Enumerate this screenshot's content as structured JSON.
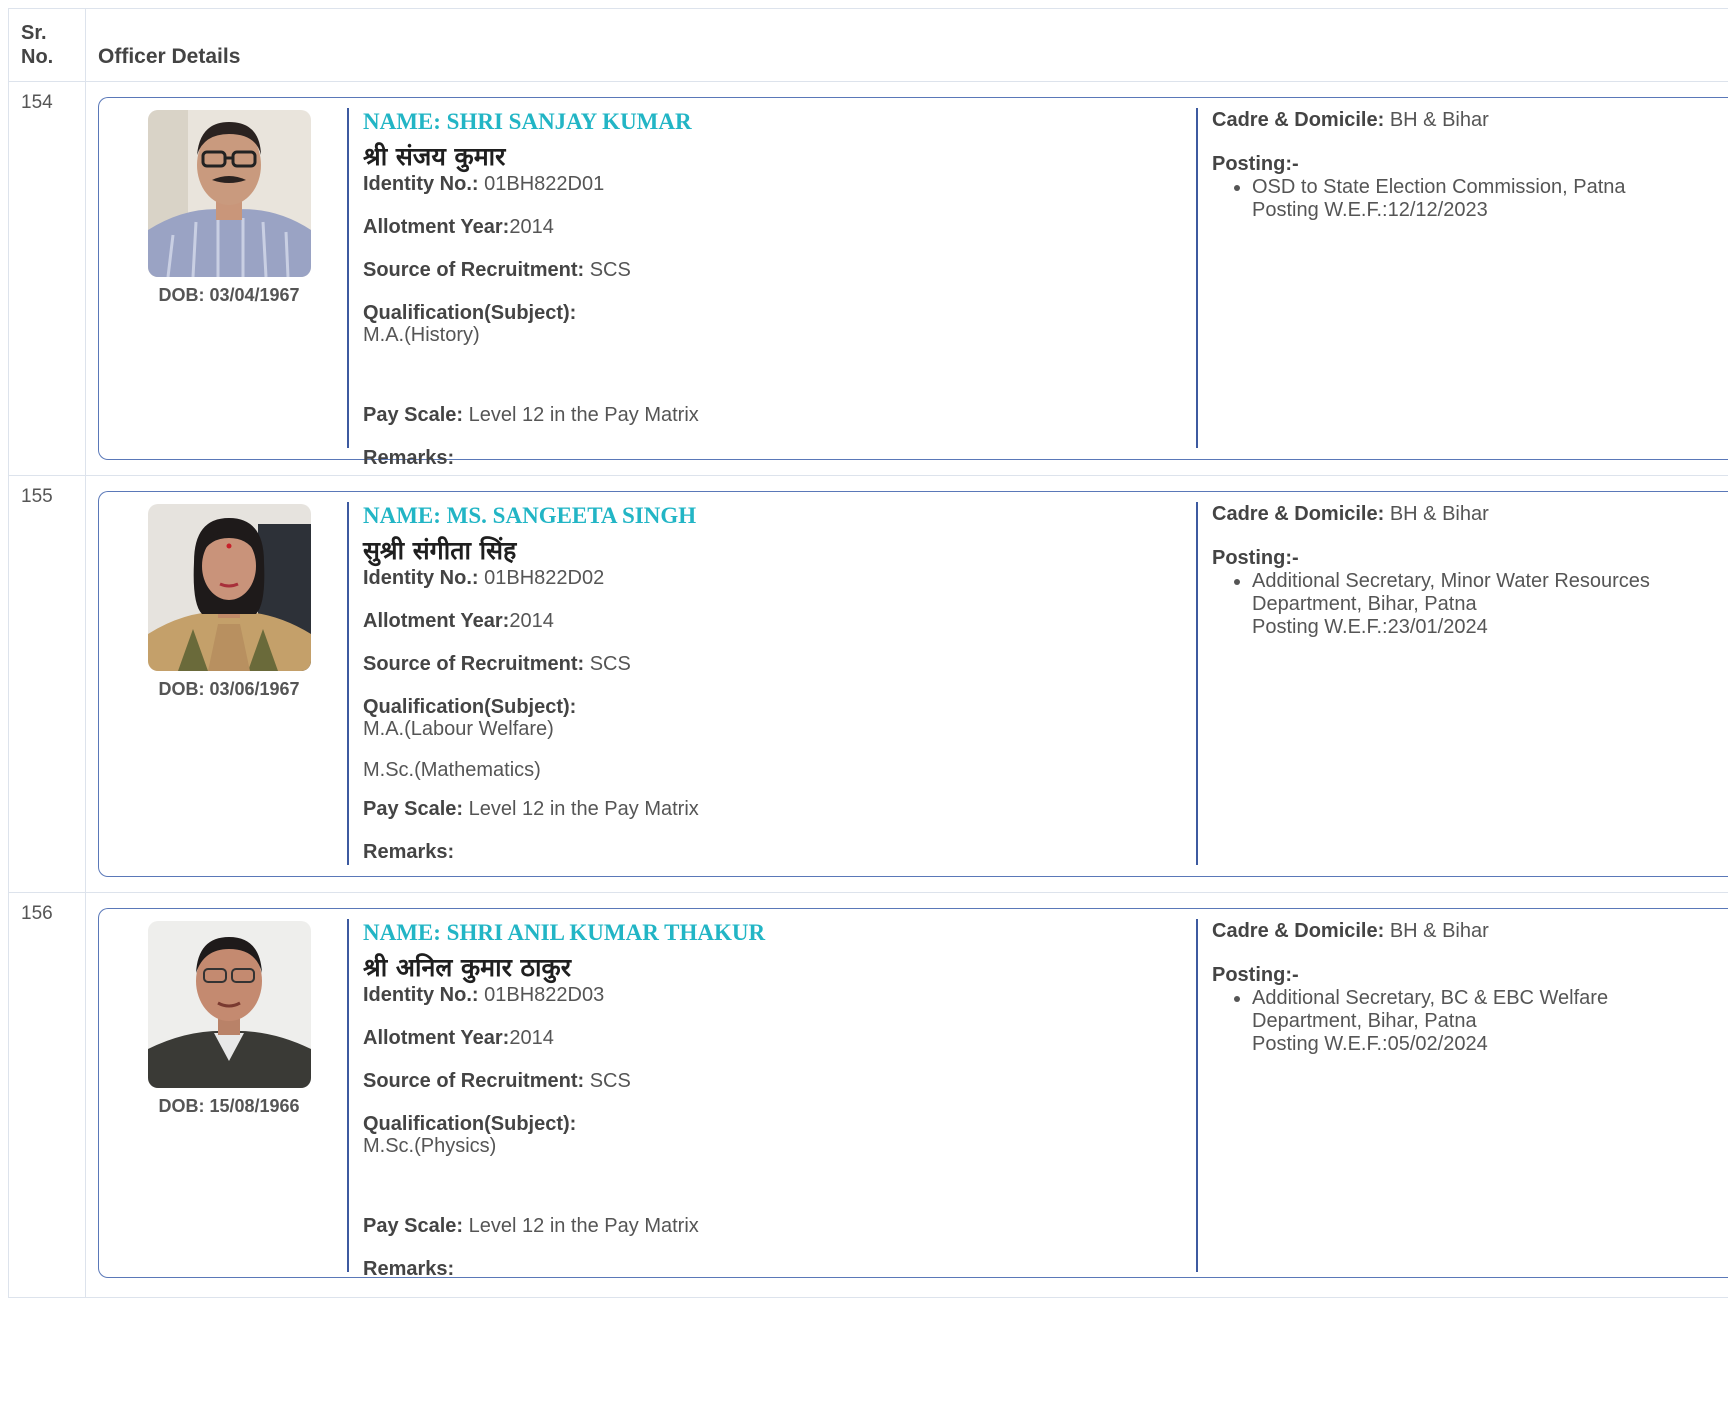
{
  "table": {
    "col_sr": "Sr. No.",
    "col_sr_line1": "Sr.",
    "col_sr_line2": "No.",
    "col_details": "Officer Details"
  },
  "labels": {
    "dob": "DOB:",
    "name": "NAME:",
    "identity": "Identity No.:",
    "allotment": "Allotment Year:",
    "source": "Source of Recruitment:",
    "qualification": "Qualification(Subject):",
    "pay_scale": "Pay Scale:",
    "remarks": "Remarks:",
    "cadre": "Cadre & Domicile:",
    "posting": "Posting:-",
    "posting_wef": "Posting W.E.F.:"
  },
  "officers": [
    {
      "sr": "154",
      "dob": "DOB: 03/04/1967",
      "name": "NAME: SHRI SANJAY KUMAR",
      "name_hindi": "श्री संजय कुमार",
      "identity_no": "01BH822D01",
      "allotment_year": "2014",
      "source": "SCS",
      "qualification_1": "M.A.(History)",
      "qualification_2": "",
      "pay_scale": "Level 12 in the Pay Matrix",
      "remarks": "",
      "cadre_domicile": "BH & Bihar",
      "posting_line_1": "OSD to State Election Commission, Patna",
      "posting_line_2": "",
      "posting_wef": "Posting W.E.F.:12/12/2023"
    },
    {
      "sr": "155",
      "dob": "DOB: 03/06/1967",
      "name": "NAME: MS. SANGEETA SINGH",
      "name_hindi": "सुश्री संगीता सिंह",
      "identity_no": "01BH822D02",
      "allotment_year": "2014",
      "source": "SCS",
      "qualification_1": "M.A.(Labour Welfare)",
      "qualification_2": "M.Sc.(Mathematics)",
      "pay_scale": "Level 12 in the Pay Matrix",
      "remarks": "",
      "cadre_domicile": "BH & Bihar",
      "posting_line_1": "Additional Secretary, Minor Water Resources",
      "posting_line_2": "Department, Bihar, Patna",
      "posting_wef": "Posting W.E.F.:23/01/2024"
    },
    {
      "sr": "156",
      "dob": "DOB: 15/08/1966",
      "name": "NAME: SHRI ANIL KUMAR THAKUR",
      "name_hindi": "श्री अनिल कुमार ठाकुर",
      "identity_no": "01BH822D03",
      "allotment_year": "2014",
      "source": "SCS",
      "qualification_1": "M.Sc.(Physics)",
      "qualification_2": "",
      "pay_scale": "Level 12 in the Pay Matrix",
      "remarks": "",
      "cadre_domicile": "BH & Bihar",
      "posting_line_1": "Additional Secretary, BC & EBC Welfare",
      "posting_line_2": "Department, Bihar, Patna",
      "posting_wef": "Posting W.E.F.:05/02/2024"
    }
  ]
}
